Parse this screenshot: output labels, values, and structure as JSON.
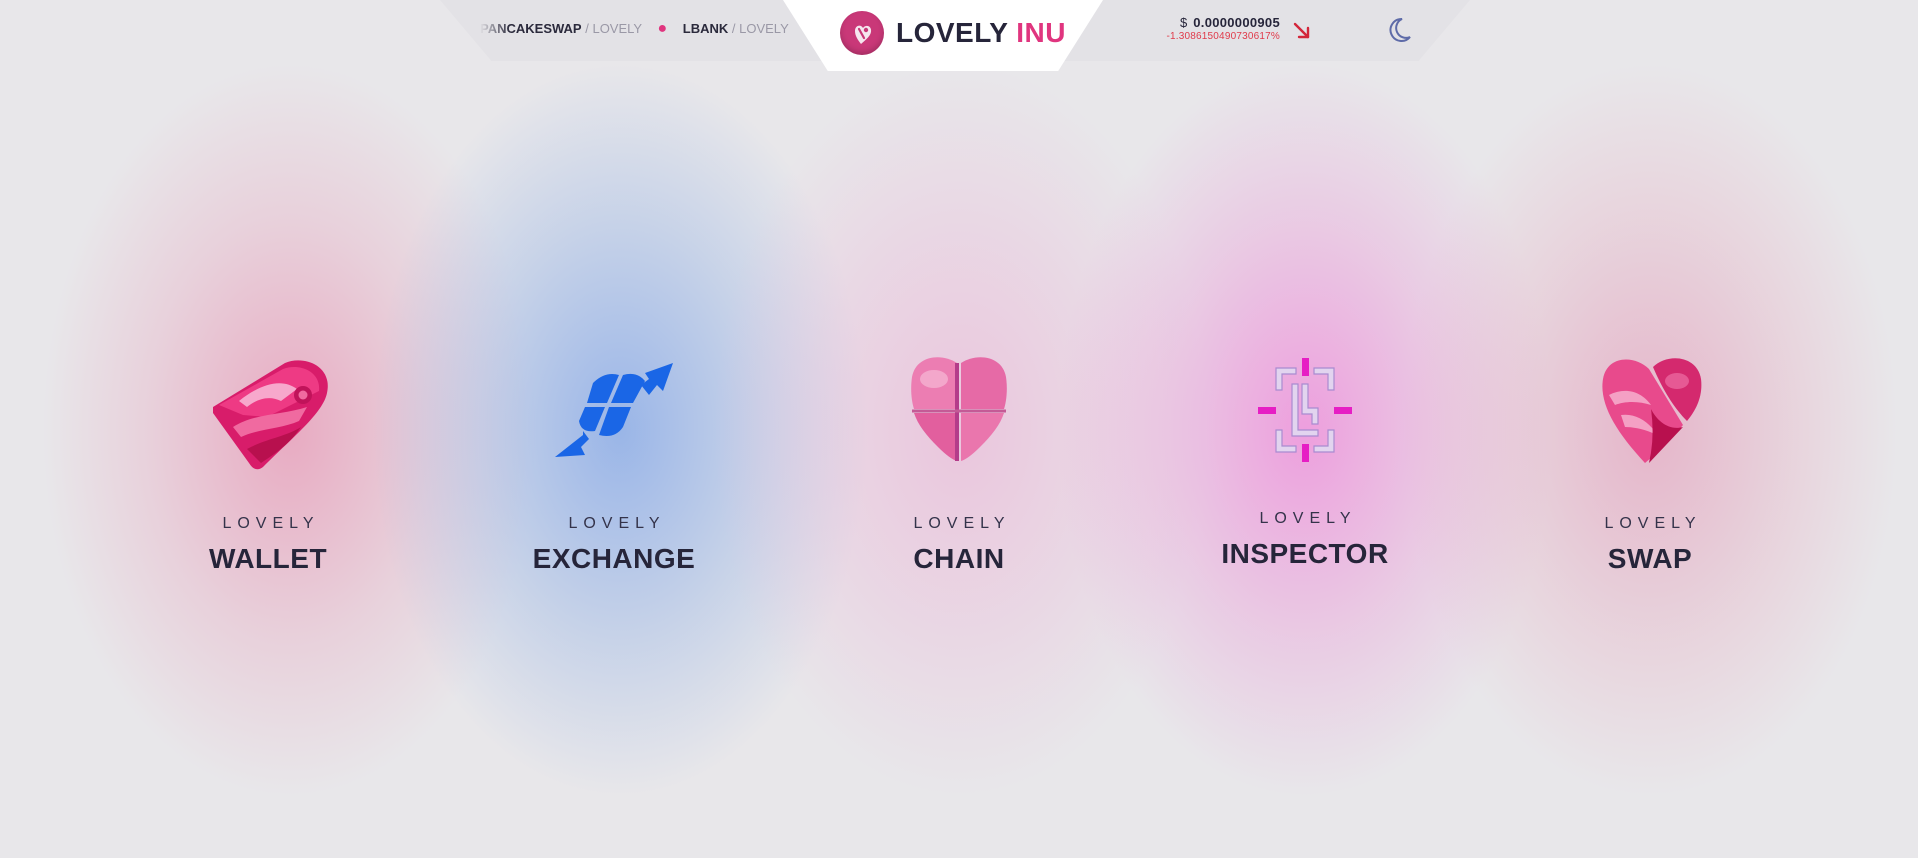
{
  "topbar": {
    "ticker": [
      {
        "exchange": "PANCAKESWAP",
        "pair": "/ LOVELY"
      },
      {
        "exchange": "LBANK",
        "pair": "/ LOVELY"
      }
    ],
    "brand": {
      "part1": "LOVELY",
      "part2": "INU"
    },
    "price": {
      "currency": "$",
      "value": "0.0000000905",
      "change": "-1.3086150490730617%"
    },
    "trend_icon": "arrow-down-right-icon",
    "theme_icon": "moon-icon"
  },
  "products": [
    {
      "prefix": "LOVELY",
      "name": "WALLET",
      "icon": "wallet-heart-icon"
    },
    {
      "prefix": "LOVELY",
      "name": "EXCHANGE",
      "icon": "exchange-arrows-icon"
    },
    {
      "prefix": "LOVELY",
      "name": "CHAIN",
      "icon": "chain-heart-icon"
    },
    {
      "prefix": "LOVELY",
      "name": "INSPECTOR",
      "icon": "inspector-target-icon"
    },
    {
      "prefix": "LOVELY",
      "name": "SWAP",
      "icon": "swap-heart-icon"
    }
  ],
  "colors": {
    "accent": "#e0357f",
    "dark": "#26253a",
    "exchange_blue": "#1a66e6",
    "inspector_magenta": "#e61ec4",
    "negative": "#e03a4a"
  }
}
